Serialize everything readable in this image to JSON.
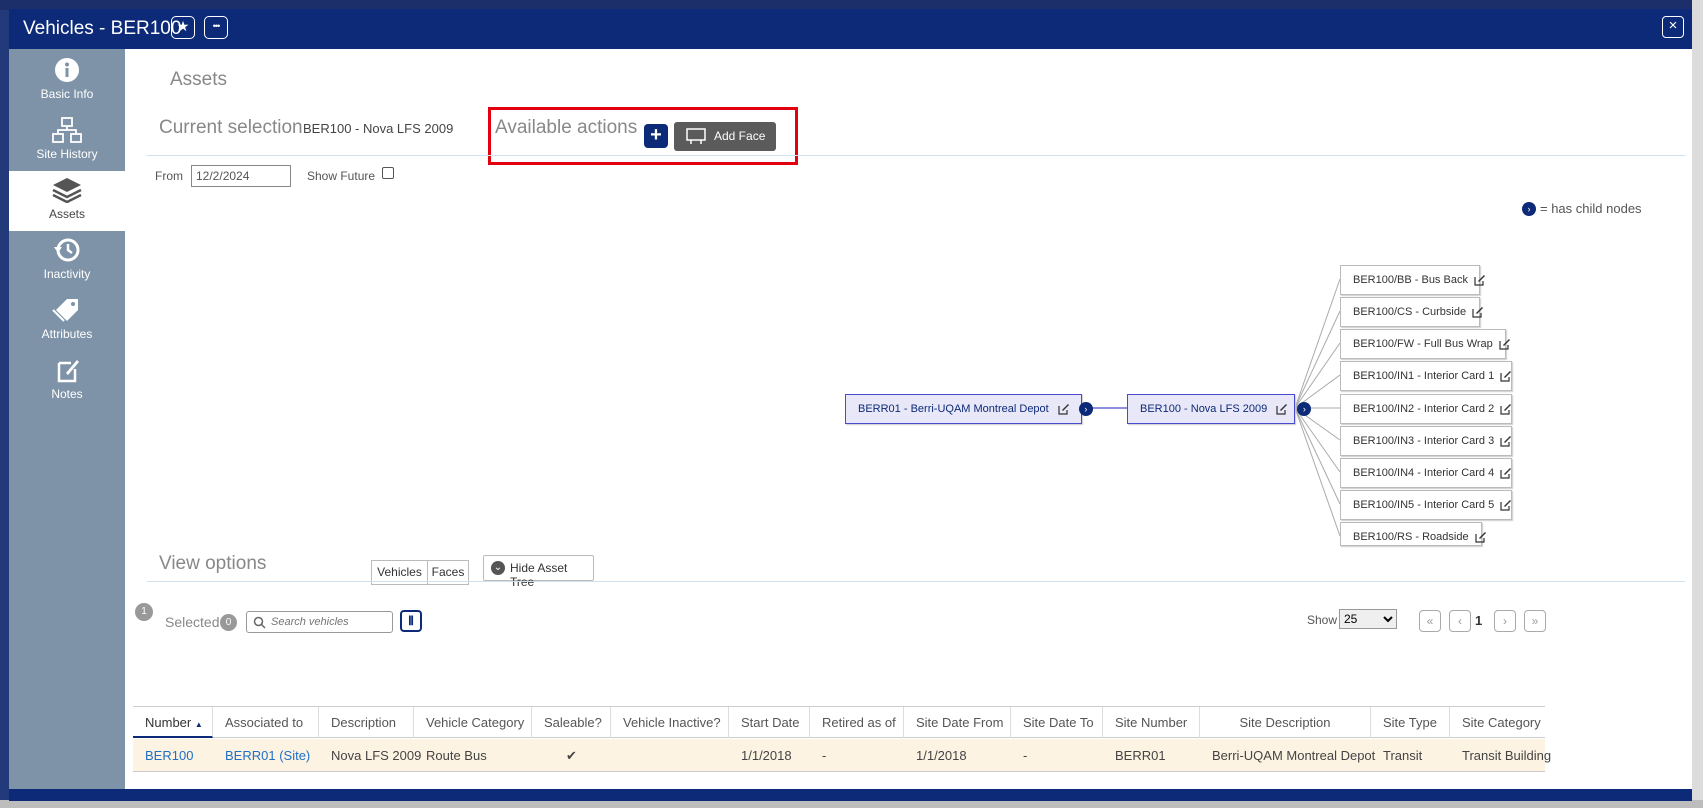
{
  "window": {
    "title": "Vehicles - BER100",
    "star_icon": "★",
    "more_icon": "•••",
    "close_icon": "×"
  },
  "sidebar": {
    "items": [
      {
        "label": "Basic Info",
        "icon": "info-icon"
      },
      {
        "label": "Site History",
        "icon": "sitemap-icon"
      },
      {
        "label": "Assets",
        "icon": "layers-icon",
        "active": true
      },
      {
        "label": "Inactivity",
        "icon": "history-icon"
      },
      {
        "label": "Attributes",
        "icon": "tags-icon"
      },
      {
        "label": "Notes",
        "icon": "note-icon"
      }
    ]
  },
  "main": {
    "section_title": "Assets",
    "current_selection_label": "Current selection",
    "current_selection_value": "BER100 - Nova LFS 2009",
    "available_actions_label": "Available actions",
    "add_icon": "+",
    "add_face_label": "Add Face",
    "from_label": "From",
    "from_value": "12/2/2024",
    "show_future_label": "Show Future",
    "legend_dot": "›",
    "legend_text": "= has child nodes"
  },
  "tree": {
    "root": "BERR01 - Berri-UQAM Montreal Depot",
    "selected": "BER100 - Nova LFS 2009",
    "children": [
      "BER100/BB - Bus Back",
      "BER100/CS - Curbside",
      "BER100/FW - Full Bus Wrap",
      "BER100/IN1 - Interior Card 1",
      "BER100/IN2 - Interior Card 2",
      "BER100/IN3 - Interior Card 3",
      "BER100/IN4 - Interior Card 4",
      "BER100/IN5 - Interior Card 5",
      "BER100/RS - Roadside"
    ],
    "child_dot": "›"
  },
  "view_options": {
    "label": "View options",
    "vehicles_btn": "Vehicles",
    "faces_btn": "Faces",
    "hide_tree_label": "Hide Asset Tree",
    "hide_tree_icon": "⌄"
  },
  "list": {
    "count_badge": "1",
    "selected_label": "Selected",
    "selected_count": "0",
    "search_placeholder": "Search vehicles",
    "columns_icon": "⦀",
    "show_label": "Show",
    "show_value": "25",
    "page_first": "«",
    "page_prev": "‹",
    "page_current": "1",
    "page_next": "›",
    "page_last": "»"
  },
  "table": {
    "headers": [
      "Number",
      "Associated to",
      "Description",
      "Vehicle Category",
      "Saleable?",
      "Vehicle Inactive?",
      "Start Date",
      "Retired as of",
      "Site Date From",
      "Site Date To",
      "Site Number",
      "Site Description",
      "Site Type",
      "Site Category"
    ],
    "sort_indicator": "▲",
    "rows": [
      {
        "number": "BER100",
        "associated_to": "BERR01 (Site)",
        "description": "Nova LFS 2009",
        "vehicle_category": "Route Bus",
        "saleable": "✔",
        "vehicle_inactive": "",
        "start_date": "1/1/2018",
        "retired_as_of": "-",
        "site_date_from": "1/1/2018",
        "site_date_to": "-",
        "site_number": "BERR01",
        "site_description": "Berri-UQAM Montreal Depot",
        "site_type": "Transit",
        "site_category": "Transit Building"
      }
    ]
  },
  "colors": {
    "brand": "#0d2a78",
    "sidebar": "#7e93a8",
    "highlight": "#e3000f",
    "row_highlight": "#fdf3e3"
  }
}
